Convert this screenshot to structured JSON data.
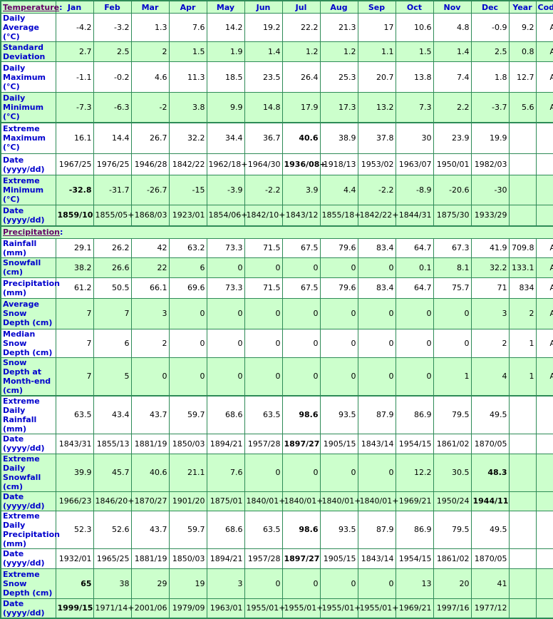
{
  "header": {
    "temperature_label": "Temperature",
    "months": [
      "Jan",
      "Feb",
      "Mar",
      "Apr",
      "May",
      "Jun",
      "Jul",
      "Aug",
      "Sep",
      "Oct",
      "Nov",
      "Dec"
    ],
    "year_label": "Year",
    "code_label": "Code"
  },
  "temperature_rows": [
    {
      "label": "Daily Average (°C)",
      "values": [
        "-4.2",
        "-3.2",
        "1.3",
        "7.6",
        "14.2",
        "19.2",
        "22.2",
        "21.3",
        "17",
        "10.6",
        "4.8",
        "-0.9"
      ],
      "year": "9.2",
      "code": "A",
      "bold_index": -1,
      "bg": "w"
    },
    {
      "label": "Standard Deviation",
      "values": [
        "2.7",
        "2.5",
        "2",
        "1.5",
        "1.9",
        "1.4",
        "1.2",
        "1.2",
        "1.1",
        "1.5",
        "1.4",
        "2.5"
      ],
      "year": "0.8",
      "code": "A",
      "bold_index": -1,
      "bg": "g"
    },
    {
      "label": "Daily Maximum (°C)",
      "values": [
        "-1.1",
        "-0.2",
        "4.6",
        "11.3",
        "18.5",
        "23.5",
        "26.4",
        "25.3",
        "20.7",
        "13.8",
        "7.4",
        "1.8"
      ],
      "year": "12.7",
      "code": "A",
      "bold_index": -1,
      "bg": "w"
    },
    {
      "label": "Daily Minimum (°C)",
      "values": [
        "-7.3",
        "-6.3",
        "-2",
        "3.8",
        "9.9",
        "14.8",
        "17.9",
        "17.3",
        "13.2",
        "7.3",
        "2.2",
        "-3.7"
      ],
      "year": "5.6",
      "code": "A",
      "bold_index": -1,
      "bg": "g"
    },
    {
      "label": "Extreme Maximum (°C)",
      "values": [
        "16.1",
        "14.4",
        "26.7",
        "32.2",
        "34.4",
        "36.7",
        "40.6",
        "38.9",
        "37.8",
        "30",
        "23.9",
        "19.9"
      ],
      "year": "",
      "code": "",
      "bold_index": 6,
      "bg": "w",
      "group_start": true
    },
    {
      "label": "Date (yyyy/dd)",
      "values": [
        "1967/25",
        "1976/25",
        "1946/28",
        "1842/22",
        "1962/18+",
        "1964/30",
        "1936/08+",
        "1918/13",
        "1953/02",
        "1963/07",
        "1950/01",
        "1982/03"
      ],
      "year": "",
      "code": "",
      "bold_index": 6,
      "bg": "w"
    },
    {
      "label": "Extreme Minimum (°C)",
      "values": [
        "-32.8",
        "-31.7",
        "-26.7",
        "-15",
        "-3.9",
        "-2.2",
        "3.9",
        "4.4",
        "-2.2",
        "-8.9",
        "-20.6",
        "-30"
      ],
      "year": "",
      "code": "",
      "bold_index": 0,
      "bg": "g"
    },
    {
      "label": "Date (yyyy/dd)",
      "values": [
        "1859/10",
        "1855/05+",
        "1868/03",
        "1923/01",
        "1854/06+",
        "1842/10+",
        "1843/12",
        "1855/18+",
        "1842/22+",
        "1844/31",
        "1875/30",
        "1933/29"
      ],
      "year": "",
      "code": "",
      "bold_index": 0,
      "bg": "g"
    }
  ],
  "precipitation_label": "Precipitation",
  "precipitation_rows": [
    {
      "label": "Rainfall (mm)",
      "values": [
        "29.1",
        "26.2",
        "42",
        "63.2",
        "73.3",
        "71.5",
        "67.5",
        "79.6",
        "83.4",
        "64.7",
        "67.3",
        "41.9"
      ],
      "year": "709.8",
      "code": "A",
      "bold_index": -1,
      "bg": "w"
    },
    {
      "label": "Snowfall (cm)",
      "values": [
        "38.2",
        "26.6",
        "22",
        "6",
        "0",
        "0",
        "0",
        "0",
        "0",
        "0.1",
        "8.1",
        "32.2"
      ],
      "year": "133.1",
      "code": "A",
      "bold_index": -1,
      "bg": "g"
    },
    {
      "label": "Precipitation (mm)",
      "values": [
        "61.2",
        "50.5",
        "66.1",
        "69.6",
        "73.3",
        "71.5",
        "67.5",
        "79.6",
        "83.4",
        "64.7",
        "75.7",
        "71"
      ],
      "year": "834",
      "code": "A",
      "bold_index": -1,
      "bg": "w"
    },
    {
      "label": "Average Snow Depth (cm)",
      "values": [
        "7",
        "7",
        "3",
        "0",
        "0",
        "0",
        "0",
        "0",
        "0",
        "0",
        "0",
        "3"
      ],
      "year": "2",
      "code": "A",
      "bold_index": -1,
      "bg": "g"
    },
    {
      "label": "Median Snow Depth (cm)",
      "values": [
        "7",
        "6",
        "2",
        "0",
        "0",
        "0",
        "0",
        "0",
        "0",
        "0",
        "0",
        "2"
      ],
      "year": "1",
      "code": "A",
      "bold_index": -1,
      "bg": "w"
    },
    {
      "label": "Snow Depth at Month-end (cm)",
      "values": [
        "7",
        "5",
        "0",
        "0",
        "0",
        "0",
        "0",
        "0",
        "0",
        "0",
        "1",
        "4"
      ],
      "year": "1",
      "code": "A",
      "bold_index": -1,
      "bg": "g"
    },
    {
      "label": "Extreme Daily Rainfall (mm)",
      "values": [
        "63.5",
        "43.4",
        "43.7",
        "59.7",
        "68.6",
        "63.5",
        "98.6",
        "93.5",
        "87.9",
        "86.9",
        "79.5",
        "49.5"
      ],
      "year": "",
      "code": "",
      "bold_index": 6,
      "bg": "w",
      "group_start": true
    },
    {
      "label": "Date (yyyy/dd)",
      "values": [
        "1843/31",
        "1855/13",
        "1881/19",
        "1850/03",
        "1894/21",
        "1957/28",
        "1897/27",
        "1905/15",
        "1843/14",
        "1954/15",
        "1861/02",
        "1870/05"
      ],
      "year": "",
      "code": "",
      "bold_index": 6,
      "bg": "w"
    },
    {
      "label": "Extreme Daily Snowfall (cm)",
      "values": [
        "39.9",
        "45.7",
        "40.6",
        "21.1",
        "7.6",
        "0",
        "0",
        "0",
        "0",
        "12.2",
        "30.5",
        "48.3"
      ],
      "year": "",
      "code": "",
      "bold_index": 11,
      "bg": "g"
    },
    {
      "label": "Date (yyyy/dd)",
      "values": [
        "1966/23",
        "1846/20+",
        "1870/27",
        "1901/20",
        "1875/01",
        "1840/01+",
        "1840/01+",
        "1840/01+",
        "1840/01+",
        "1969/21",
        "1950/24",
        "1944/11"
      ],
      "year": "",
      "code": "",
      "bold_index": 11,
      "bg": "g"
    },
    {
      "label": "Extreme Daily Precipitation (mm)",
      "values": [
        "52.3",
        "52.6",
        "43.7",
        "59.7",
        "68.6",
        "63.5",
        "98.6",
        "93.5",
        "87.9",
        "86.9",
        "79.5",
        "49.5"
      ],
      "year": "",
      "code": "",
      "bold_index": 6,
      "bg": "w"
    },
    {
      "label": "Date (yyyy/dd)",
      "values": [
        "1932/01",
        "1965/25",
        "1881/19",
        "1850/03",
        "1894/21",
        "1957/28",
        "1897/27",
        "1905/15",
        "1843/14",
        "1954/15",
        "1861/02",
        "1870/05"
      ],
      "year": "",
      "code": "",
      "bold_index": 6,
      "bg": "w"
    },
    {
      "label": "Extreme Snow Depth (cm)",
      "values": [
        "65",
        "38",
        "29",
        "19",
        "3",
        "0",
        "0",
        "0",
        "0",
        "13",
        "20",
        "41"
      ],
      "year": "",
      "code": "",
      "bold_index": 0,
      "bg": "g"
    },
    {
      "label": "Date (yyyy/dd)",
      "values": [
        "1999/15",
        "1971/14+",
        "2001/06",
        "1979/09",
        "1963/01",
        "1955/01+",
        "1955/01+",
        "1955/01+",
        "1955/01+",
        "1969/21",
        "1997/16",
        "1977/12"
      ],
      "year": "",
      "code": "",
      "bold_index": 0,
      "bg": "g"
    }
  ]
}
